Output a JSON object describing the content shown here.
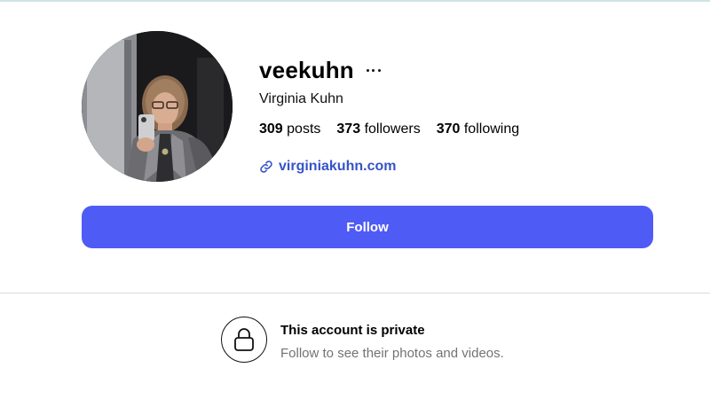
{
  "profile": {
    "username": "veekuhn",
    "full_name": "Virginia Kuhn",
    "avatar_alt": "profile picture",
    "website": "virginiakuhn.com",
    "stats": [
      {
        "count": "309",
        "label": "posts"
      },
      {
        "count": "373",
        "label": "followers"
      },
      {
        "count": "370",
        "label": "following"
      }
    ]
  },
  "actions": {
    "follow_label": "Follow"
  },
  "private_notice": {
    "title": "This account is private",
    "subtitle": "Follow to see their photos and videos."
  },
  "icons": {
    "more": "more-options-icon",
    "link": "link-icon",
    "lock": "lock-icon"
  },
  "colors": {
    "follow_button": "#4f5bf5",
    "link": "#3654c7",
    "secondary_text": "#737373"
  }
}
